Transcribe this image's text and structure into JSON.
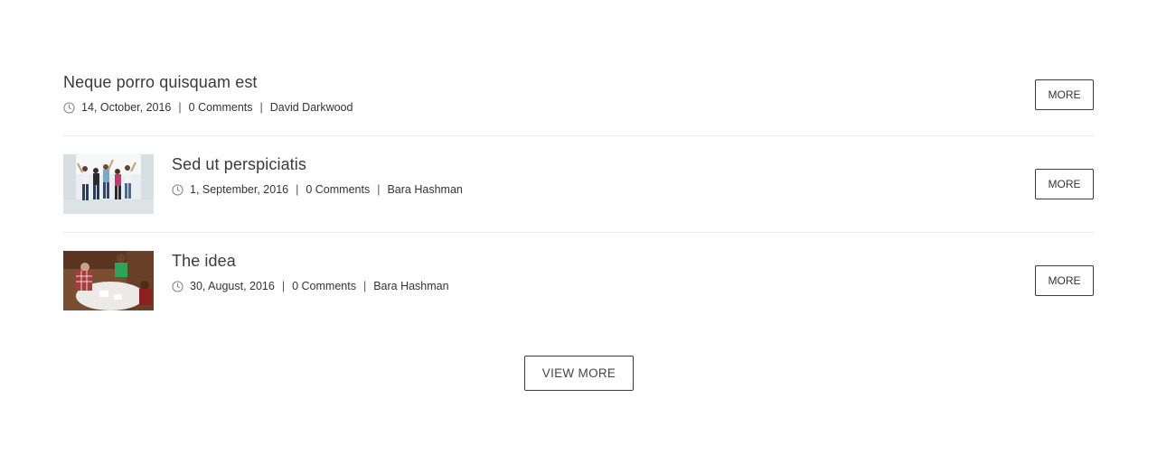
{
  "posts": [
    {
      "title": "Neque porro quisquam est",
      "date": "14, October, 2016",
      "comments": "0 Comments",
      "author": "David Darkwood",
      "more_label": "MORE"
    },
    {
      "title": "Sed ut perspiciatis",
      "date": "1, September, 2016",
      "comments": "0 Comments",
      "author": "Bara Hashman",
      "more_label": "MORE",
      "thumbnail": "group-jumping-photo"
    },
    {
      "title": "The idea",
      "date": "30, August, 2016",
      "comments": "0 Comments",
      "author": "Bara Hashman",
      "more_label": "MORE",
      "thumbnail": "team-meeting-photo"
    }
  ],
  "separator": "|",
  "view_more_label": "VIEW MORE",
  "icons": {
    "date": "clock-icon"
  }
}
